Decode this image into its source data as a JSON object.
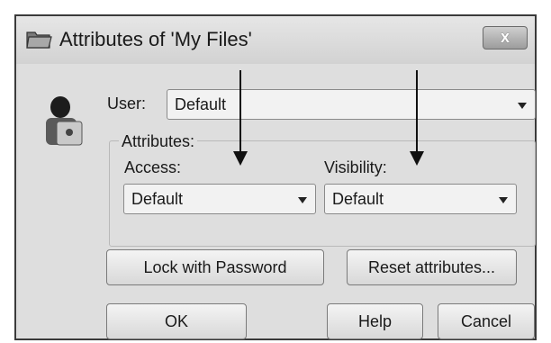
{
  "window": {
    "title": "Attributes of 'My Files'"
  },
  "user": {
    "label": "User:",
    "value": "Default"
  },
  "attributes": {
    "group_label": "Attributes:",
    "access": {
      "label": "Access:",
      "value": "Default"
    },
    "visibility": {
      "label": "Visibility:",
      "value": "Default"
    }
  },
  "buttons": {
    "lock": "Lock with Password",
    "reset": "Reset attributes...",
    "ok": "OK",
    "help": "Help",
    "cancel": "Cancel",
    "close": "x"
  },
  "icons": {
    "title": "folder-icon",
    "user": "user-lock-icon",
    "close": "close-icon"
  }
}
